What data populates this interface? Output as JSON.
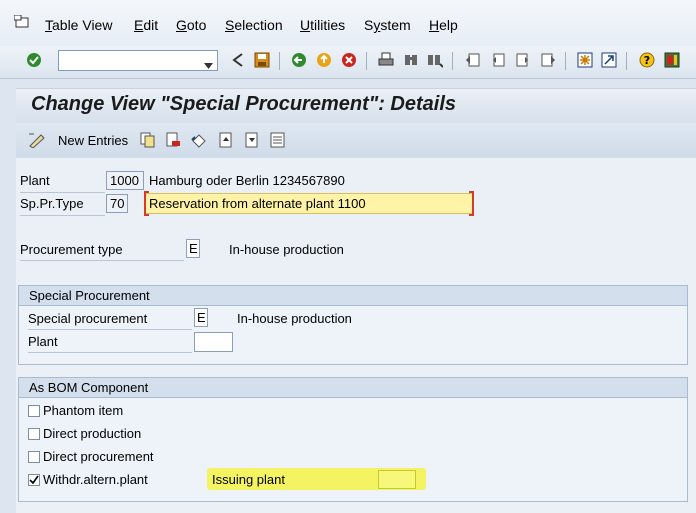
{
  "menu": {
    "items": [
      "Table View",
      "Edit",
      "Goto",
      "Selection",
      "Utilities",
      "System",
      "Help"
    ],
    "underline_letters": [
      "T",
      "E",
      "G",
      "S",
      "U",
      "y",
      "H"
    ]
  },
  "toolbar": {
    "command_field_value": "",
    "icons": [
      "enter-icon",
      "back-icon",
      "save-icon",
      "back-green-icon",
      "exit-icon",
      "cancel-icon",
      "print-icon",
      "find-icon",
      "find-next-icon",
      "first-page-icon",
      "prev-page-icon",
      "next-page-icon",
      "last-page-icon",
      "new-session-icon",
      "shortcut-icon",
      "help-icon",
      "layout-icon"
    ]
  },
  "title": "Change View \"Special Procurement\": Details",
  "app_toolbar": {
    "new_entries_label": "New Entries"
  },
  "header_fields": {
    "plant_label": "Plant",
    "plant_value": "1000",
    "plant_desc": "Hamburg oder Berlin 1234567890",
    "sptype_label": "Sp.Pr.Type",
    "sptype_value": "70",
    "sptype_desc": "Reservation from alternate plant 1100"
  },
  "procurement": {
    "label": "Procurement type",
    "value": "E",
    "desc": "In-house production"
  },
  "special_procurement_group": {
    "title": "Special Procurement",
    "sp_label": "Special procurement",
    "sp_value": "E",
    "sp_desc": "In-house production",
    "plant_label": "Plant",
    "plant_value": ""
  },
  "bom_group": {
    "title": "As BOM Component",
    "checkboxes": [
      {
        "label": "Phantom item",
        "checked": false
      },
      {
        "label": "Direct production",
        "checked": false
      },
      {
        "label": "Direct procurement",
        "checked": false
      },
      {
        "label": "Withdr.altern.plant",
        "checked": true
      }
    ],
    "issuing_plant_label": "Issuing plant",
    "issuing_plant_value": "",
    "highlight_color": "#f3f35a"
  },
  "colors": {
    "accent_green": "#2f8a2f",
    "field_highlight": "#fff3a8"
  }
}
